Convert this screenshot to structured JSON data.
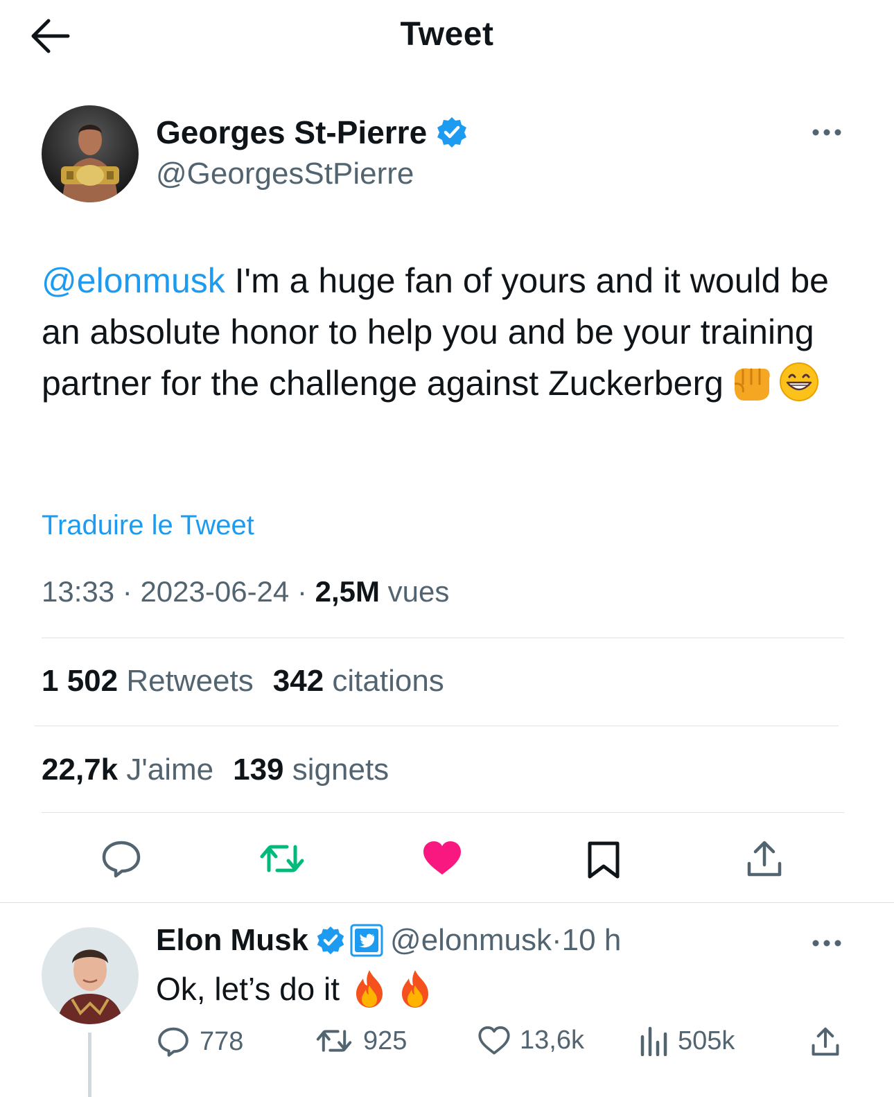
{
  "header": {
    "title": "Tweet"
  },
  "tweet": {
    "author": {
      "name": "Georges St-Pierre",
      "handle": "@GeorgesStPierre",
      "verified": true
    },
    "text": {
      "mention": "@elonmusk",
      "body": " I'm a huge fan of yours and it would be an absolute honor to help you and be your training partner for the challenge against Zuckerberg",
      "emojis": [
        "oncoming-fist-emoji",
        "grinning-face-emoji"
      ]
    },
    "translate_label": "Traduire le Tweet",
    "time": "13:33",
    "sep1": " · ",
    "date": "2023-06-24",
    "sep2": " · ",
    "views_count": "2,5M",
    "views_label": " vues",
    "stats": {
      "retweets_count": "1 502",
      "retweets_label": " Retweets",
      "quotes_count": "342",
      "quotes_label": " citations",
      "likes_count": "22,7k",
      "likes_label": " J'aime",
      "bookmarks_count": "139",
      "bookmarks_label": " signets"
    },
    "actions": [
      "reply-icon",
      "retweet-icon",
      "like-icon",
      "bookmark-icon",
      "share-icon"
    ],
    "liked": true
  },
  "reply": {
    "author": {
      "name": "Elon Musk",
      "handle": "@elonmusk",
      "verified": true,
      "affiliate_badge": "twitter-bird-badge"
    },
    "dot": " · ",
    "time": "10 h",
    "text": "Ok, let’s do it",
    "emojis": [
      "fire-emoji",
      "fire-emoji"
    ],
    "counts": {
      "replies": "778",
      "retweets": "925",
      "likes": "13,6k",
      "views": "505k"
    }
  },
  "colors": {
    "accent": "#1d9bf0",
    "text": "#0f1419",
    "secondary": "#536471",
    "like": "#f91880",
    "retweet": "#00ba7c",
    "divider": "#dfe3e6"
  }
}
